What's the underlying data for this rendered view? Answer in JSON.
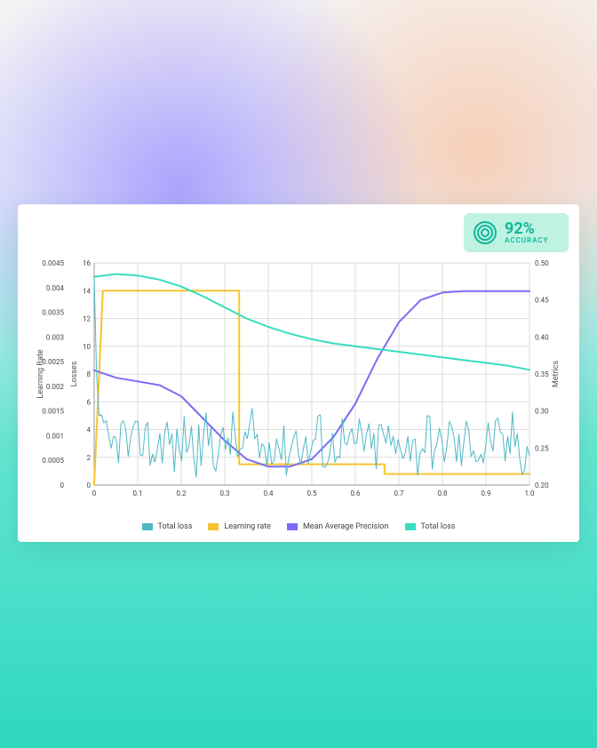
{
  "badge": {
    "value": "92%",
    "label": "ACCURACY"
  },
  "legend": [
    {
      "label": "Total  loss",
      "color": "#4fb8c7"
    },
    {
      "label": "Learning rate",
      "color": "#f4c430"
    },
    {
      "label": "Mean Average Precision",
      "color": "#7b6cf6"
    },
    {
      "label": "Total loss",
      "color": "#38dcc0"
    }
  ],
  "axis_titles": {
    "left_outer": "Learning Rate",
    "left_inner": "Losses",
    "right": "Metrics"
  },
  "chart_data": {
    "type": "line",
    "x": {
      "label": "",
      "range": [
        0,
        1
      ],
      "ticks": [
        0,
        0.1,
        0.2,
        0.3,
        0.4,
        0.5,
        0.6,
        0.7,
        0.8,
        0.9,
        1.0
      ]
    },
    "y_learning_rate": {
      "label": "Learning Rate",
      "range": [
        0,
        0.0045
      ],
      "ticks": [
        0,
        0.0005,
        0.001,
        0.0015,
        0.002,
        0.0025,
        0.003,
        0.0035,
        0.004,
        0.0045
      ]
    },
    "y_losses": {
      "label": "Losses",
      "range": [
        0,
        16
      ],
      "ticks": [
        0,
        2,
        4,
        6,
        8,
        10,
        12,
        14,
        16
      ]
    },
    "y_metrics": {
      "label": "Metrics",
      "range": [
        0.2,
        0.5
      ],
      "ticks": [
        0.2,
        0.25,
        0.3,
        0.35,
        0.4,
        0.45,
        0.5
      ]
    },
    "series": [
      {
        "name": "Learning rate",
        "yaxis": "y_losses",
        "color": "#f4c430",
        "x": [
          0,
          0.02,
          0.333,
          0.333,
          0.667,
          0.667,
          1.0
        ],
        "y": [
          0,
          14,
          14,
          1.5,
          1.5,
          0.8,
          0.8
        ]
      },
      {
        "name": "Mean Average Precision",
        "yaxis": "y_metrics",
        "color": "#7b6cf6",
        "x": [
          0,
          0.05,
          0.1,
          0.15,
          0.2,
          0.25,
          0.3,
          0.35,
          0.4,
          0.45,
          0.5,
          0.55,
          0.6,
          0.65,
          0.7,
          0.75,
          0.8,
          0.85,
          0.9,
          0.95,
          1.0
        ],
        "y": [
          0.355,
          0.345,
          0.34,
          0.335,
          0.32,
          0.29,
          0.26,
          0.235,
          0.225,
          0.225,
          0.235,
          0.265,
          0.31,
          0.37,
          0.42,
          0.45,
          0.46,
          0.462,
          0.462,
          0.462,
          0.462
        ]
      },
      {
        "name": "Total loss (smooth)",
        "yaxis": "y_losses",
        "color": "#38dcc0",
        "x": [
          0,
          0.05,
          0.1,
          0.15,
          0.2,
          0.25,
          0.3,
          0.35,
          0.4,
          0.45,
          0.5,
          0.55,
          0.6,
          0.65,
          0.7,
          0.75,
          0.8,
          0.85,
          0.9,
          0.95,
          1.0
        ],
        "y": [
          15.0,
          15.2,
          15.1,
          14.8,
          14.3,
          13.6,
          12.8,
          12.0,
          11.4,
          10.9,
          10.5,
          10.2,
          10.0,
          9.8,
          9.6,
          9.4,
          9.2,
          9.0,
          8.8,
          8.6,
          8.3
        ]
      },
      {
        "name": "Total  loss (noisy)",
        "yaxis": "y_losses",
        "color": "#4fb8c7",
        "x_range": [
          0,
          1
        ],
        "n": 180,
        "initial": [
          15.0,
          8.0,
          5.0
        ],
        "mean": 3.0,
        "noise": 2.0
      }
    ]
  }
}
